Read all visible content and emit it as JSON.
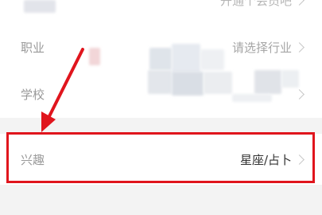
{
  "top_row": {
    "value": "开通个会员吧"
  },
  "occupation": {
    "label": "职业",
    "value": "请选择行业"
  },
  "school": {
    "label": "学校"
  },
  "interest": {
    "label": "兴趣",
    "value": "星座/占卜"
  },
  "colors": {
    "annotation": "#e0151d"
  }
}
